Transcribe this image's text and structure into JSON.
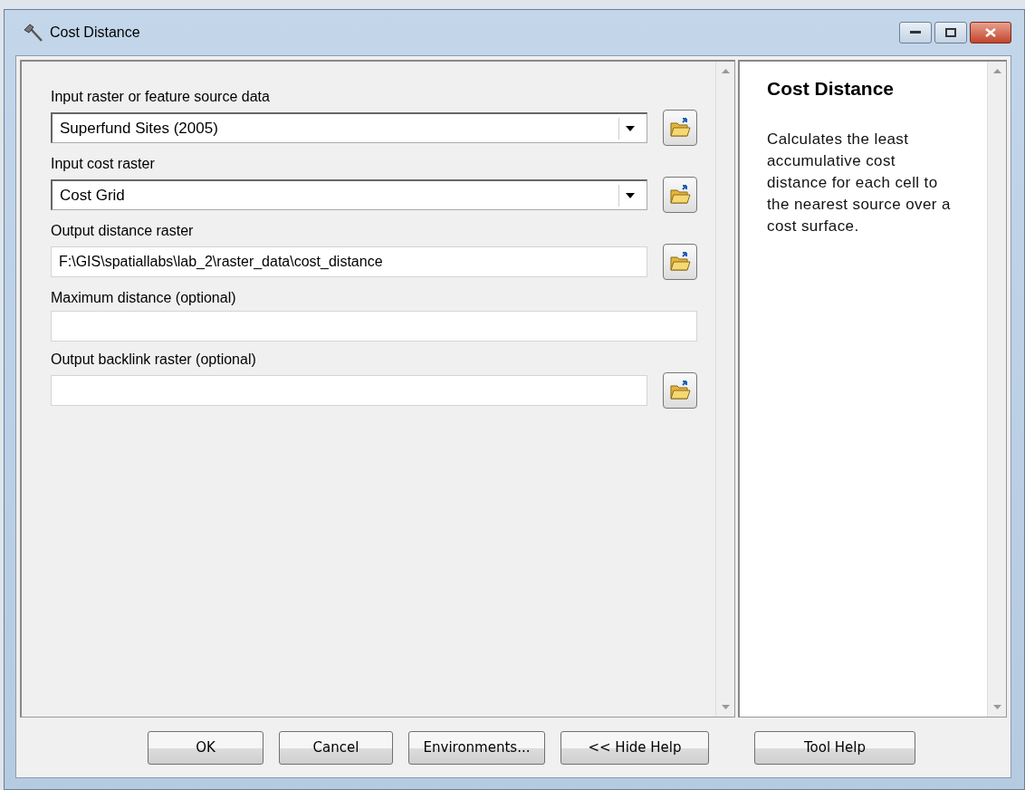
{
  "window": {
    "title": "Cost Distance"
  },
  "parameters": [
    {
      "label": "Input raster or feature source data",
      "kind": "dropdown",
      "value": "Superfund Sites (2005)",
      "browse": true
    },
    {
      "label": "Input cost raster",
      "kind": "dropdown",
      "value": "Cost Grid",
      "browse": true
    },
    {
      "label": "Output distance raster",
      "kind": "text",
      "value": "F:\\GIS\\spatiallabs\\lab_2\\raster_data\\cost_distance",
      "browse": true
    },
    {
      "label": "Maximum distance (optional)",
      "kind": "text",
      "browse": false
    },
    {
      "label": "Output backlink raster (optional)",
      "kind": "text",
      "browse": true
    }
  ],
  "help": {
    "title": "Cost Distance",
    "text": "Calculates the least accumulative cost distance for each cell to the nearest source over a cost surface."
  },
  "buttons": [
    "OK",
    "Cancel",
    "Environments...",
    "<< Hide Help",
    "Tool Help"
  ]
}
